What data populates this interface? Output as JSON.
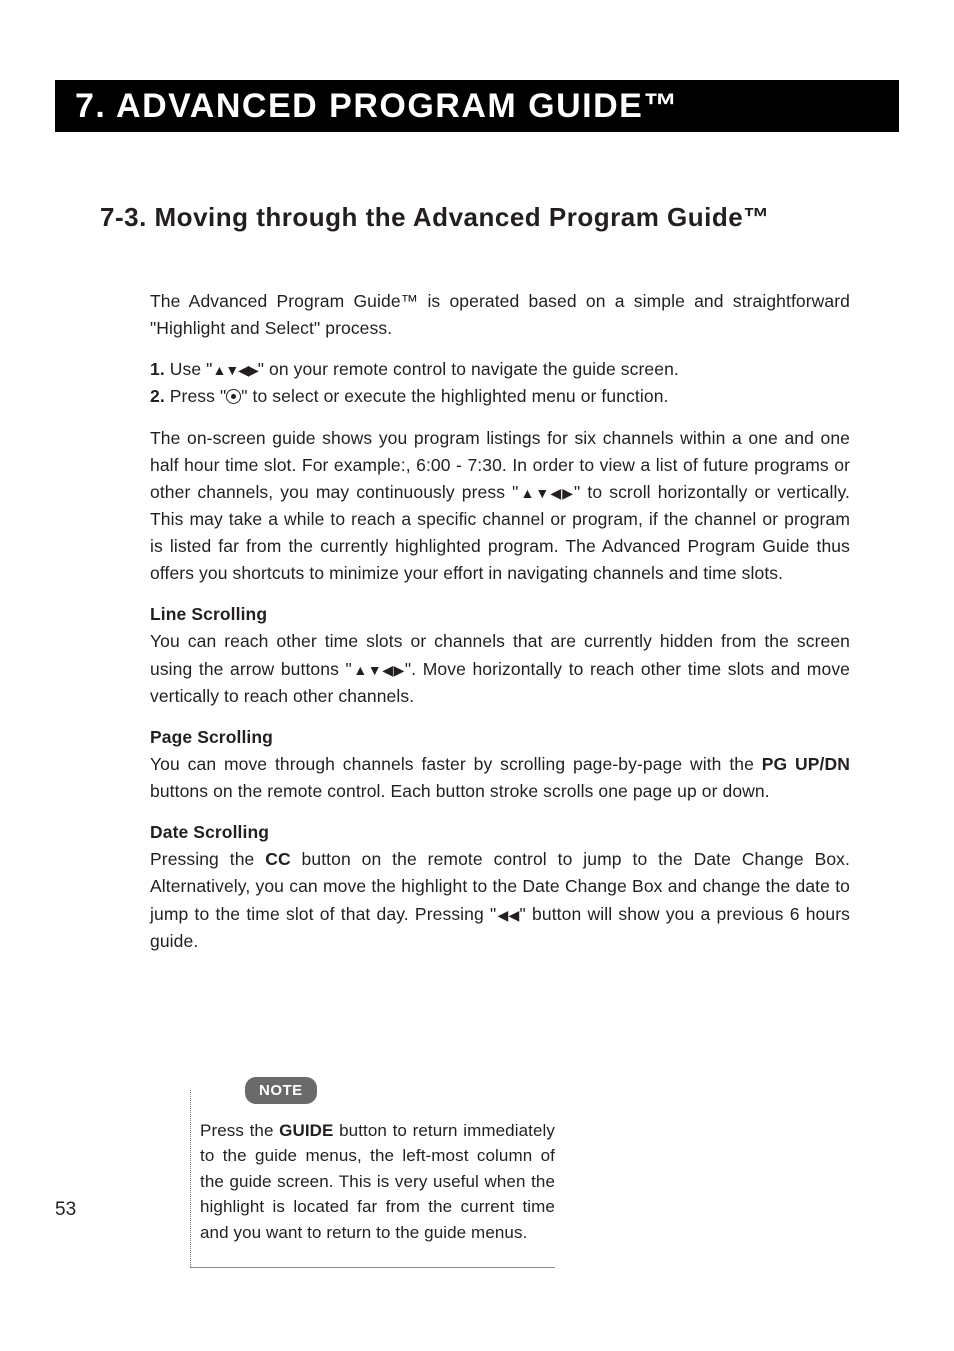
{
  "chapter_bar": "7. ADVANCED PROGRAM GUIDE™",
  "section_title": "7-3. Moving through the Advanced Program Guide™",
  "intro": "The Advanced Program Guide™ is operated based on a simple and straightforward \"Highlight and Select\" process.",
  "steps": {
    "n1": "1.",
    "s1a": " Use  \"",
    "s1b": "\" on your remote control to navigate the guide screen.",
    "n2": "2.",
    "s2a": " Press \"",
    "s2b": "\" to select or execute the highlighted menu or function."
  },
  "para_onscreen_a": "The on-screen guide shows you program listings for six channels within a one and one half hour time slot. For example:, 6:00 - 7:30.  In order to view a list of future programs or other channels, you may continuously press \"",
  "para_onscreen_b": "\" to scroll horizontally or vertically. This may take a while to reach a specific channel or program, if the channel or program is listed far from the currently highlighted program.  The Advanced Program Guide thus offers you shortcuts to minimize your effort in navigating channels and time slots.",
  "line_head": "Line Scrolling",
  "line_body_a": "You can reach other time slots or channels that are currently hidden from the screen using the arrow buttons \"",
  "line_body_b": "\".  Move horizontally to reach other time slots and  move vertically to reach other channels.",
  "page_head": "Page Scrolling",
  "page_body_a": "You can move through channels faster by scrolling page-by-page with the ",
  "page_body_bold": "PG UP/DN",
  "page_body_b": " buttons on the remote control. Each button stroke scrolls one page up or down.",
  "date_head": "Date Scrolling",
  "date_body_a": "Pressing the ",
  "date_body_bold": "CC",
  "date_body_b": " button on the remote control to jump to the Date Change Box. Alternatively, you can move the highlight to the Date Change Box and change the date to jump to the time slot of that day. Pressing \"",
  "date_arrows": "◀◀",
  "date_body_c": "\" button will show you a previous 6 hours guide.",
  "note_label": "NOTE",
  "note_a": "Press the ",
  "note_bold": "GUIDE",
  "note_b": " button to return immediately to the guide menus, the left-most column of the guide screen.  This is very useful when the highlight is located far from the current time and you want to return to the guide menus.",
  "page_number": "53",
  "arrows4": "▲▼◀▶"
}
